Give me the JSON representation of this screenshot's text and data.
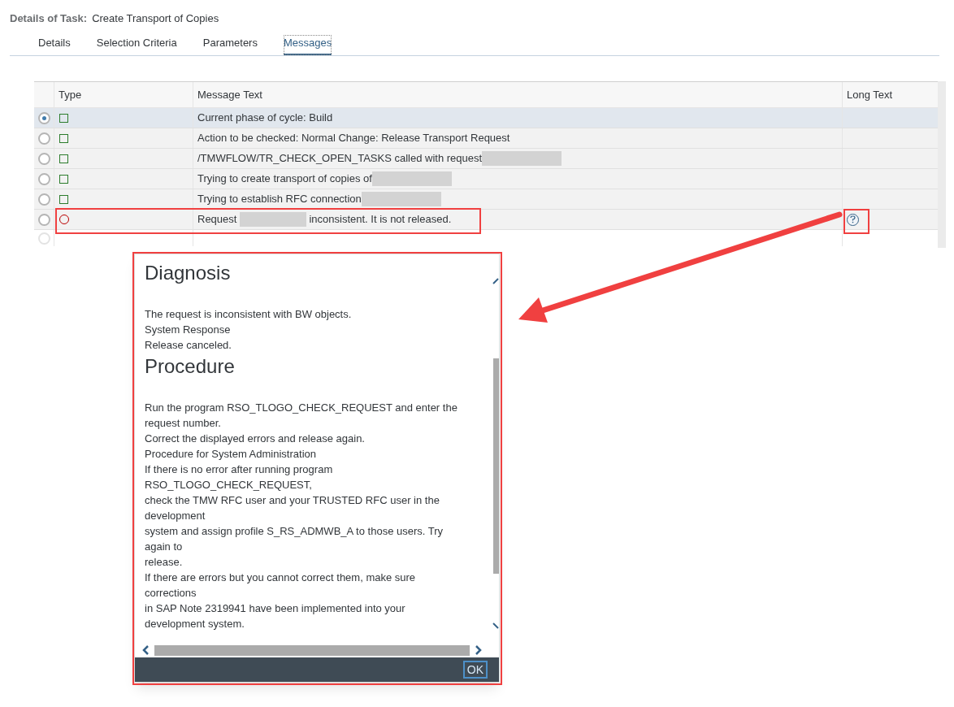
{
  "header": {
    "label": "Details of Task:",
    "title": "Create Transport of Copies"
  },
  "tabs": [
    {
      "label": "Details",
      "selected": false
    },
    {
      "label": "Selection Criteria",
      "selected": false
    },
    {
      "label": "Parameters",
      "selected": false
    },
    {
      "label": "Messages",
      "selected": true
    }
  ],
  "table": {
    "columns": [
      "Type",
      "Message Text",
      "Long Text"
    ],
    "rows": [
      {
        "selected": true,
        "kind": "success",
        "text": "Current phase of cycle: Build",
        "redacted": false,
        "long_text": false
      },
      {
        "selected": false,
        "kind": "success",
        "text": "Action to be checked: Normal Change: Release Transport Request",
        "redacted": false,
        "long_text": false
      },
      {
        "selected": false,
        "kind": "success",
        "text": "/TMWFLOW/TR_CHECK_OPEN_TASKS called with request",
        "redacted": true,
        "long_text": false
      },
      {
        "selected": false,
        "kind": "success",
        "text": "Trying to create transport of copies of",
        "redacted": true,
        "long_text": false
      },
      {
        "selected": false,
        "kind": "success",
        "text": "Trying to establish RFC connection",
        "redacted": true,
        "long_text": false
      },
      {
        "selected": false,
        "kind": "error",
        "text": "Request",
        "redacted": true,
        "text_after": "inconsistent. It is not released.",
        "long_text": true
      }
    ],
    "blank_row": {
      "disabled": true
    }
  },
  "dialog": {
    "blocks": [
      {
        "kind": "heading",
        "text": "Diagnosis"
      },
      {
        "kind": "para",
        "lines": [
          "The request is inconsistent with BW objects.",
          "System Response",
          "Release canceled."
        ]
      },
      {
        "kind": "heading",
        "text": "Procedure"
      },
      {
        "kind": "para",
        "lines": [
          "Run the program RSO_TLOGO_CHECK_REQUEST and enter the",
          "request number.",
          "Correct the displayed errors and release again.",
          "Procedure for System Administration",
          "If there is no error after running program",
          "RSO_TLOGO_CHECK_REQUEST,",
          "check the TMW RFC user and your TRUSTED RFC user in the",
          "development",
          "system and assign profile S_RS_ADMWB_A to those users. Try",
          "again to",
          "release.",
          "If there are errors but you cannot correct them, make sure",
          "corrections",
          "in SAP Note 2319941 have been implemented into your",
          "development system."
        ]
      }
    ],
    "ok_button": "OK"
  }
}
